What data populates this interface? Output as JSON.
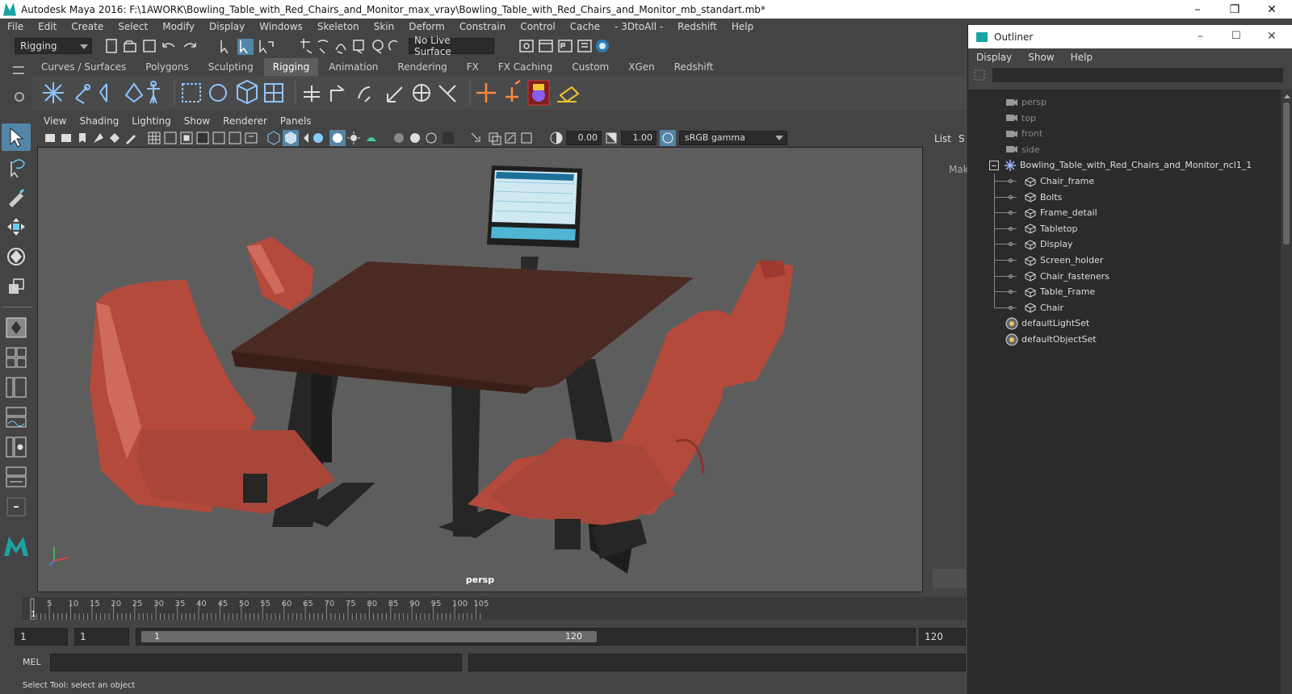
{
  "window": {
    "title": "Autodesk Maya 2016: F:\\1AWORK\\Bowling_Table_with_Red_Chairs_and_Monitor_max_vray\\Bowling_Table_with_Red_Chairs_and_Monitor_mb_standart.mb*"
  },
  "menubar": {
    "items": [
      "File",
      "Edit",
      "Create",
      "Select",
      "Modify",
      "Display",
      "Windows",
      "Skeleton",
      "Skin",
      "Deform",
      "Constrain",
      "Control",
      "Cache",
      "- 3DtoAll -",
      "Redshift",
      "Help"
    ]
  },
  "status": {
    "menuset": "Rigging",
    "live_surface": "No Live Surface"
  },
  "shelf": {
    "tabs": [
      "Curves / Surfaces",
      "Polygons",
      "Sculpting",
      "Rigging",
      "Animation",
      "Rendering",
      "FX",
      "FX Caching",
      "Custom",
      "XGen",
      "Redshift"
    ],
    "active": "Rigging"
  },
  "viewport": {
    "menu": [
      "View",
      "Shading",
      "Lighting",
      "Show",
      "Renderer",
      "Panels"
    ],
    "exposure": "0.00",
    "gamma": "1.00",
    "colorspace": "sRGB gamma",
    "camera_label": "persp"
  },
  "channel_box": {
    "tabs": [
      "List",
      "S"
    ],
    "make_label": "Mak"
  },
  "timeline": {
    "ticks": [
      "5",
      "10",
      "15",
      "20",
      "25",
      "30",
      "35",
      "40",
      "45",
      "50",
      "55",
      "60",
      "65",
      "70",
      "75",
      "80",
      "85",
      "90",
      "95",
      "100",
      "105"
    ],
    "current": "1"
  },
  "range": {
    "start": "1",
    "playback_start": "1",
    "slider_start": "1",
    "slider_end": "120",
    "end": "120"
  },
  "command": {
    "label": "MEL"
  },
  "help_line": "Select Tool: select an object",
  "outliner": {
    "title": "Outliner",
    "menu": [
      "Display",
      "Show",
      "Help"
    ],
    "items": [
      {
        "label": "persp",
        "type": "camera",
        "dim": true
      },
      {
        "label": "top",
        "type": "camera",
        "dim": true
      },
      {
        "label": "front",
        "type": "camera",
        "dim": true
      },
      {
        "label": "side",
        "type": "camera",
        "dim": true
      },
      {
        "label": "Bowling_Table_with_Red_Chairs_and_Monitor_ncl1_1",
        "type": "group"
      },
      {
        "label": "Chair_frame",
        "type": "mesh"
      },
      {
        "label": "Bolts",
        "type": "mesh"
      },
      {
        "label": "Frame_detail",
        "type": "mesh"
      },
      {
        "label": "Tabletop",
        "type": "mesh"
      },
      {
        "label": "Display",
        "type": "mesh"
      },
      {
        "label": "Screen_holder",
        "type": "mesh"
      },
      {
        "label": "Chair_fasteners",
        "type": "mesh"
      },
      {
        "label": "Table_Frame",
        "type": "mesh"
      },
      {
        "label": "Chair",
        "type": "mesh"
      },
      {
        "label": "defaultLightSet",
        "type": "set"
      },
      {
        "label": "defaultObjectSet",
        "type": "set"
      }
    ]
  },
  "colors": {
    "accent": "#5285a6",
    "chair": "#b34a3c",
    "tabletop": "#4a2a22",
    "frame": "#262626"
  }
}
